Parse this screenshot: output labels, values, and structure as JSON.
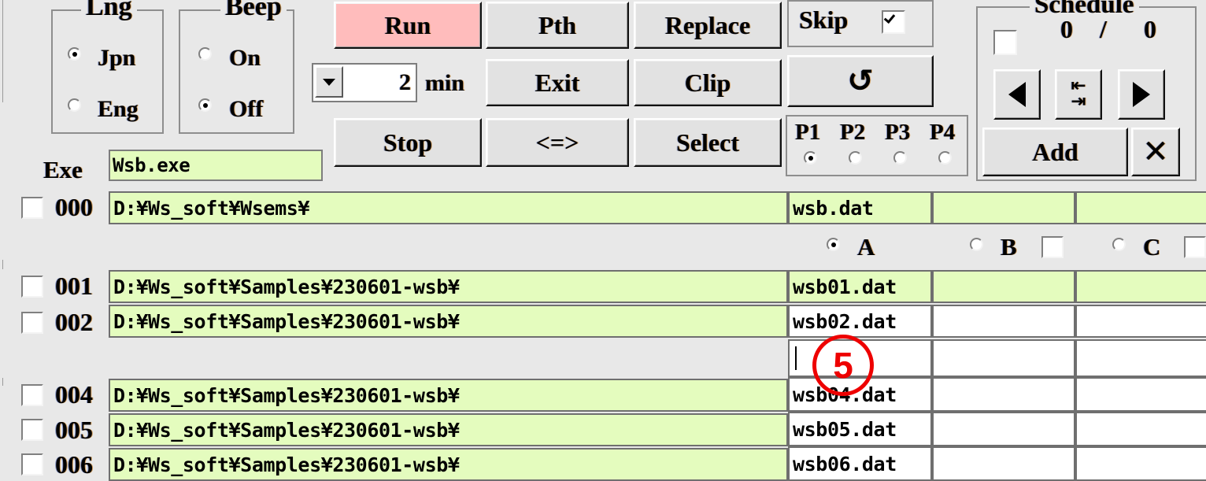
{
  "window": {
    "background": "#e8e8e8",
    "field_green": "#e4fcbe",
    "run_pink": "#ffbcbc"
  },
  "lng_group": {
    "title": "Lng",
    "options": [
      {
        "label": "Jpn",
        "selected": true
      },
      {
        "label": "Eng",
        "selected": false
      }
    ]
  },
  "beep_group": {
    "title": "Beep",
    "options": [
      {
        "label": "On",
        "selected": false
      },
      {
        "label": "Off",
        "selected": true
      }
    ]
  },
  "buttons": {
    "run": "Run",
    "pth": "Pth",
    "replace": "Replace",
    "exit": "Exit",
    "clip": "Clip",
    "stop": "Stop",
    "swap": "<=>",
    "select": "Select",
    "refresh_icon": "refresh-icon",
    "refresh_glyph": "↺"
  },
  "timer": {
    "value": "2",
    "unit": "min",
    "dropdown_icon": "chevron-down-icon"
  },
  "skip": {
    "label": "Skip",
    "checked": true
  },
  "pattern_group": {
    "labels": [
      "P1",
      "P2",
      "P3",
      "P4"
    ],
    "selected_index": 0
  },
  "schedule_group": {
    "title": "Schedule",
    "enabled": false,
    "current": "0",
    "separator": "/",
    "total": "0",
    "prev_icon": "triangle-left-icon",
    "swap_icon": "swap-arrows-icon",
    "next_icon": "triangle-right-icon",
    "swap_glyph_top": "⇤",
    "swap_glyph_bottom": "⇥",
    "add_label": "Add",
    "delete_glyph": "✕"
  },
  "exe": {
    "label": "Exe",
    "value": "Wsb.exe"
  },
  "abc_selector": {
    "items": [
      {
        "label": "A",
        "selected": true,
        "has_checkbox": false,
        "checked": false
      },
      {
        "label": "B",
        "selected": false,
        "has_checkbox": true,
        "checked": false
      },
      {
        "label": "C",
        "selected": false,
        "has_checkbox": true,
        "checked": false
      }
    ]
  },
  "table": {
    "rows": [
      {
        "num": "000",
        "has_checkbox": true,
        "checked": false,
        "path": "D:¥Ws_soft¥Wsems¥",
        "path_green": true,
        "file": "wsb.dat",
        "file_green": true,
        "col3_green": true,
        "col4_green": true,
        "show_path": true,
        "show_file": true
      },
      {
        "num": "001",
        "has_checkbox": true,
        "checked": false,
        "path": "D:¥Ws_soft¥Samples¥230601-wsb¥",
        "path_green": true,
        "file": "wsb01.dat",
        "file_green": true,
        "col3_green": true,
        "col4_green": true,
        "show_path": true,
        "show_file": true
      },
      {
        "num": "002",
        "has_checkbox": true,
        "checked": false,
        "path": "D:¥Ws_soft¥Samples¥230601-wsb¥",
        "path_green": true,
        "file": "wsb02.dat",
        "file_green": false,
        "col3_green": false,
        "col4_green": false,
        "show_path": true,
        "show_file": true
      },
      {
        "num": "",
        "has_checkbox": false,
        "checked": false,
        "path": "",
        "path_green": false,
        "file": "",
        "file_green": false,
        "col3_green": false,
        "col4_green": false,
        "show_path": false,
        "show_file": true
      },
      {
        "num": "004",
        "has_checkbox": true,
        "checked": false,
        "path": "D:¥Ws_soft¥Samples¥230601-wsb¥",
        "path_green": true,
        "file": "wsb04.dat",
        "file_green": false,
        "col3_green": false,
        "col4_green": false,
        "show_path": true,
        "show_file": true
      },
      {
        "num": "005",
        "has_checkbox": true,
        "checked": false,
        "path": "D:¥Ws_soft¥Samples¥230601-wsb¥",
        "path_green": true,
        "file": "wsb05.dat",
        "file_green": false,
        "col3_green": false,
        "col4_green": false,
        "show_path": true,
        "show_file": true
      },
      {
        "num": "006",
        "has_checkbox": true,
        "checked": false,
        "path": "D:¥Ws_soft¥Samples¥230601-wsb¥",
        "path_green": true,
        "file": "wsb06.dat",
        "file_green": false,
        "col3_green": false,
        "col4_green": false,
        "show_path": true,
        "show_file": true
      }
    ]
  },
  "annotation": {
    "marker": "5",
    "color": "#ee0000"
  }
}
